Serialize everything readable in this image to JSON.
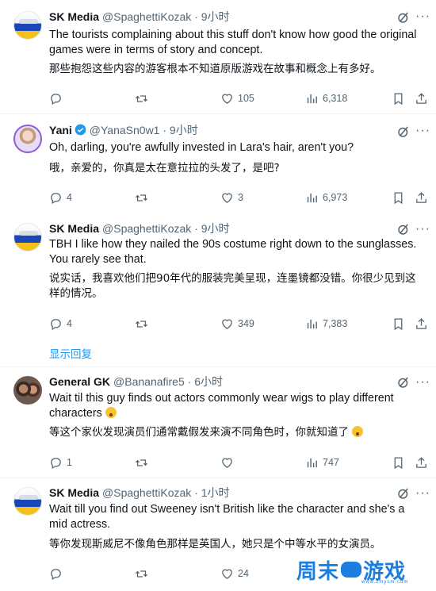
{
  "colors": {
    "accent": "#1d9bf0",
    "muted": "#536471",
    "text": "#0f1419",
    "verified": "#1d9bf0"
  },
  "tweets": [
    {
      "name": "SK Media",
      "handle": "@SpaghettiKozak",
      "time": "· 9小时",
      "text_en": "The tourists complaining about this stuff don't know how good the original games were in terms of story and concept.",
      "text_cn": "那些抱怨这些内容的游客根本不知道原版游戏在故事和概念上有多好。",
      "replies": "",
      "retweets": "",
      "likes": "105",
      "views": "6,318"
    },
    {
      "name": "Yani",
      "handle": "@YanaSn0w1",
      "time": "· 9小时",
      "text_en": "Oh, darling, you're awfully invested in Lara's hair, aren't you?",
      "text_cn": "哦，亲爱的，你真是太在意拉拉的头发了，是吧?",
      "replies": "4",
      "retweets": "",
      "likes": "3",
      "views": "6,973"
    },
    {
      "name": "SK Media",
      "handle": "@SpaghettiKozak",
      "time": "· 9小时",
      "text_en": "TBH I like how they nailed the 90s costume right down to the sunglasses. You rarely see that.",
      "text_cn": "说实话，我喜欢他们把90年代的服装完美呈现，连墨镜都没错。你很少见到这样的情况。",
      "replies": "4",
      "retweets": "",
      "likes": "349",
      "views": "7,383"
    },
    {
      "name": "General GK",
      "handle": "@Bananafire5",
      "time": "· 6小时",
      "text_en": "Wait til this guy finds out actors commonly wear wigs to play different characters",
      "text_cn": "等这个家伙发现演员们通常戴假发来演不同角色时，你就知道了",
      "replies": "1",
      "retweets": "",
      "likes": "",
      "views": "747"
    },
    {
      "name": "SK Media",
      "handle": "@SpaghettiKozak",
      "time": "· 1小时",
      "text_en": "Wait till you find out Sweeney isn't British like the character and she's a mid actress.",
      "text_cn": "等你发现斯威尼不像角色那样是英国人，她只是个中等水平的女演员。",
      "replies": "",
      "retweets": "",
      "likes": "24",
      "views": ""
    }
  ],
  "show_replies": "显示回复",
  "more_glyph": "···",
  "watermark": {
    "text_left": "周末",
    "text_right": "游戏",
    "sub": "www.zmysm.com"
  }
}
